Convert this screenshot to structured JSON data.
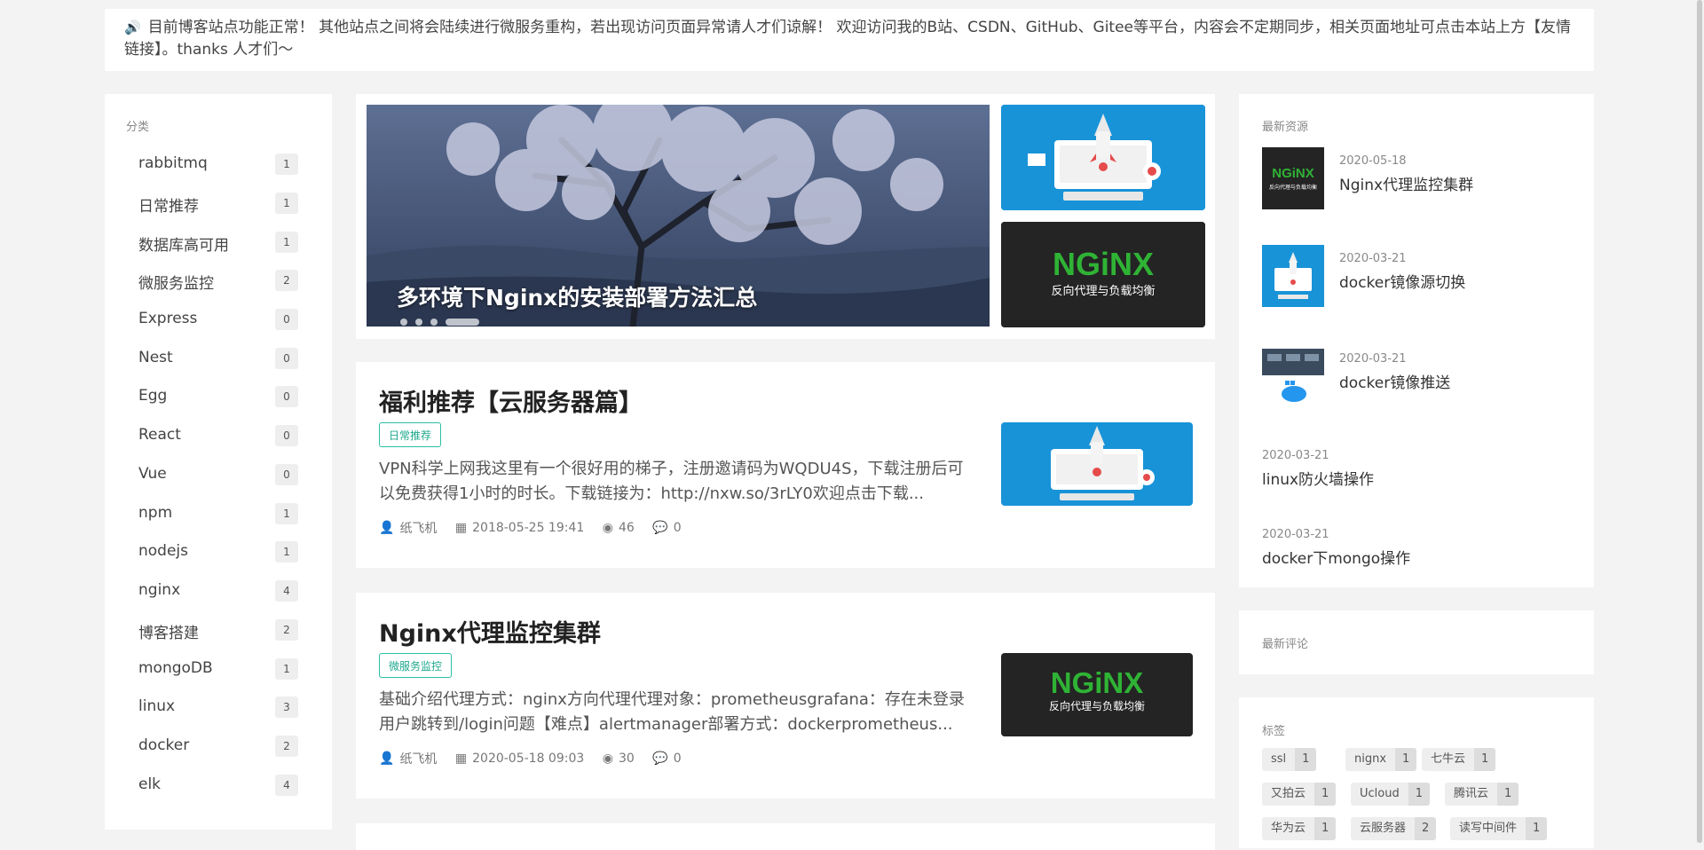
{
  "notice": {
    "icon": "megaphone-icon",
    "text": "目前博客站点功能正常！ 其他站点之间将会陆续进行微服务重构，若出现访问页面异常请人才们谅解！ 欢迎访问我的B站、CSDN、GitHub、Gitee等平台，内容会不定期同步，相关页面地址可点击本站上方【友情链接】。thanks 人才们～"
  },
  "categories": {
    "title": "分类",
    "items": [
      {
        "name": "rabbitmq",
        "count": "1"
      },
      {
        "name": "日常推荐",
        "count": "1"
      },
      {
        "name": "数据库高可用",
        "count": "1"
      },
      {
        "name": "微服务监控",
        "count": "2"
      },
      {
        "name": "Express",
        "count": "0"
      },
      {
        "name": "Nest",
        "count": "0"
      },
      {
        "name": "Egg",
        "count": "0"
      },
      {
        "name": "React",
        "count": "0"
      },
      {
        "name": "Vue",
        "count": "0"
      },
      {
        "name": "npm",
        "count": "1"
      },
      {
        "name": "nodejs",
        "count": "1"
      },
      {
        "name": "nginx",
        "count": "4"
      },
      {
        "name": "博客搭建",
        "count": "2"
      },
      {
        "name": "mongoDB",
        "count": "1"
      },
      {
        "name": "linux",
        "count": "3"
      },
      {
        "name": "docker",
        "count": "2"
      },
      {
        "name": "elk",
        "count": "4"
      }
    ]
  },
  "slider": {
    "caption": "多环境下Nginx的安装部署方法汇总",
    "nginx_logo": "NGiNX",
    "nginx_sub": "反向代理与负载均衡"
  },
  "posts": [
    {
      "title": "福利推荐【云服务器篇】",
      "tag": "日常推荐",
      "excerpt": "VPN科学上网我这里有一个很好用的梯子，注册邀请码为WQDU4S，下载注册后可以免费获得1小时的时长。下载链接为：http://nxw.so/3rLY0欢迎点击下载...",
      "author": "纸飞机",
      "date": "2018-05-25 19:41",
      "views": "46",
      "comments": "0"
    },
    {
      "title": "Nginx代理监控集群",
      "tag": "微服务监控",
      "excerpt": "基础介绍代理方式：nginx方向代理代理对象：prometheusgrafana：存在未登录用户跳转到/login问题【难点】alertmanager部署方式：dockerprometheus...",
      "author": "纸飞机",
      "date": "2020-05-18 09:03",
      "views": "30",
      "comments": "0",
      "img_logo": "NGiNX",
      "img_sub": "反向代理与负载均衡"
    }
  ],
  "resources": {
    "title": "最新资源",
    "items": [
      {
        "date": "2020-05-18",
        "title": "Nginx代理监控集群",
        "logo": "NGiNX",
        "sub": "反向代理与负载均衡"
      },
      {
        "date": "2020-03-21",
        "title": "docker镜像源切换"
      },
      {
        "date": "2020-03-21",
        "title": "docker镜像推送"
      },
      {
        "date": "2020-03-21",
        "title": "linux防火墙操作"
      },
      {
        "date": "2020-03-21",
        "title": "docker下mongo操作"
      }
    ]
  },
  "comments": {
    "title": "最新评论"
  },
  "tags": {
    "title": "标签",
    "items": [
      {
        "name": "ssl",
        "count": "1"
      },
      {
        "name": "nignx",
        "count": "1"
      },
      {
        "name": "七牛云",
        "count": "1"
      },
      {
        "name": "又拍云",
        "count": "1"
      },
      {
        "name": "Ucloud",
        "count": "1"
      },
      {
        "name": "腾讯云",
        "count": "1"
      },
      {
        "name": "华为云",
        "count": "1"
      },
      {
        "name": "云服务器",
        "count": "2"
      },
      {
        "name": "读写中间件",
        "count": "1"
      }
    ]
  },
  "colors": {
    "accent": "#2bbfa3",
    "notice_icon": "#b8242c",
    "nginx_green": "#2fb335"
  }
}
